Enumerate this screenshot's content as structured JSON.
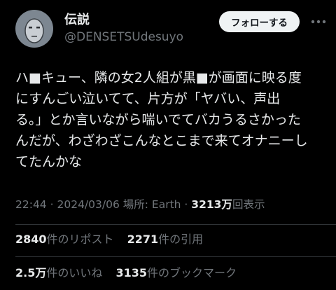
{
  "user": {
    "name": "伝説",
    "handle": "@DENSETSUdesuyo"
  },
  "follow_button": {
    "label": "フォローする"
  },
  "tweet": {
    "lines": [
      "ハ■キュー、隣の女2人組が黒■が画面に映る度",
      "にすんごい泣いてて、片方が「ヤバい、声出",
      "る。」とか言いながら喘いでてバカうるさかった",
      "んだが、わざわざこんなとこまで来てオナニーし",
      "てたんかな"
    ]
  },
  "meta": {
    "time": "22:44",
    "separator": "·",
    "date": "2024/03/06",
    "location": "場所: Earth",
    "views_count": "3213万",
    "views_label": "回表示"
  },
  "stats": {
    "retweets_count": "2840",
    "retweets_label": "件のリポスト",
    "quotes_count": "2271",
    "quotes_label": "件の引用",
    "likes_count": "2.5万",
    "likes_label": "件のいいね",
    "bookmarks_count": "3135",
    "bookmarks_label": "件のブックマーク"
  },
  "icons": {
    "more": "more-horizontal-icon",
    "avatar": "avatar-face"
  },
  "colors": {
    "background": "#000000",
    "text_primary": "#e7e9ea",
    "text_secondary": "#71767b",
    "divider": "#2f3336",
    "button_bg": "#eff3f4",
    "button_text": "#0f1419",
    "avatar_bg": "#7d8791"
  }
}
